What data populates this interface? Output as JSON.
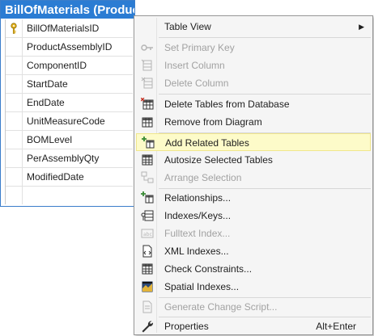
{
  "table": {
    "title": "BillOfMaterials (Production)",
    "columns": [
      {
        "name": "BillOfMaterialsID",
        "primary_key": true
      },
      {
        "name": "ProductAssemblyID"
      },
      {
        "name": "ComponentID"
      },
      {
        "name": "StartDate"
      },
      {
        "name": "EndDate"
      },
      {
        "name": "UnitMeasureCode"
      },
      {
        "name": "BOMLevel"
      },
      {
        "name": "PerAssemblyQty"
      },
      {
        "name": "ModifiedDate"
      }
    ]
  },
  "menu": {
    "items": [
      {
        "label": "Table View",
        "submenu": true,
        "icon": ""
      },
      {
        "label": "Set Primary Key",
        "disabled": true,
        "icon": "key-icon"
      },
      {
        "label": "Insert Column",
        "disabled": true,
        "icon": "insert-column-icon"
      },
      {
        "label": "Delete Column",
        "disabled": true,
        "icon": "delete-column-icon"
      },
      {
        "label": "Delete Tables from Database",
        "icon": "delete-table-icon"
      },
      {
        "label": "Remove from Diagram",
        "icon": "remove-table-icon"
      },
      {
        "label": "Add Related Tables",
        "icon": "add-related-icon",
        "highlighted": true
      },
      {
        "label": "Autosize Selected Tables",
        "icon": "autosize-icon"
      },
      {
        "label": "Arrange Selection",
        "disabled": true,
        "icon": "arrange-icon"
      },
      {
        "label": "Relationships...",
        "icon": "relationships-icon"
      },
      {
        "label": "Indexes/Keys...",
        "icon": "indexes-icon"
      },
      {
        "label": "Fulltext Index...",
        "disabled": true,
        "icon": "fulltext-icon"
      },
      {
        "label": "XML Indexes...",
        "icon": "xml-index-icon"
      },
      {
        "label": "Check Constraints...",
        "icon": "check-constraints-icon"
      },
      {
        "label": "Spatial Indexes...",
        "icon": "spatial-index-icon"
      },
      {
        "label": "Generate Change Script...",
        "disabled": true,
        "icon": "script-icon"
      },
      {
        "label": "Properties",
        "shortcut": "Alt+Enter",
        "icon": "wrench-icon"
      }
    ]
  },
  "colors": {
    "title_bar": "#2b7cd3",
    "menu_bg": "#f5f5f5",
    "highlight": "#fdfbc9",
    "disabled_text": "#a2a2a2"
  }
}
